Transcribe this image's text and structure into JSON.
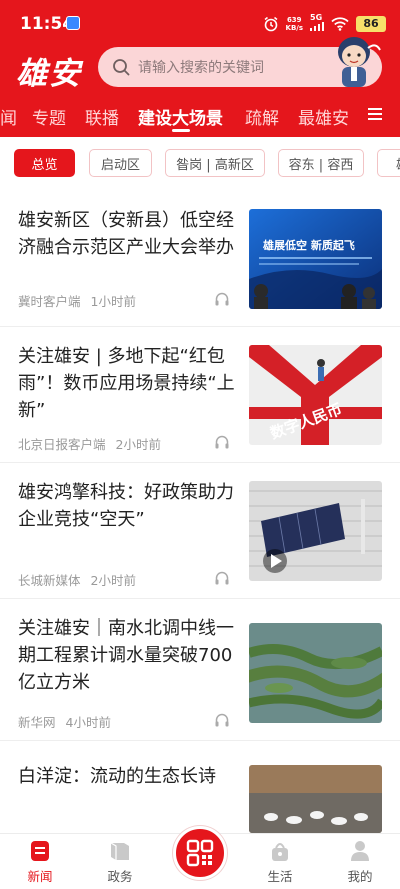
{
  "status_bar": {
    "time": "11:54",
    "net_speed_value": "639",
    "net_speed_unit": "KB/s",
    "signal": "5G",
    "battery": "86"
  },
  "header": {
    "logo": "雄安",
    "search_placeholder": "请输入搜索的关键词"
  },
  "tabs": [
    {
      "label": "闻"
    },
    {
      "label": "专题"
    },
    {
      "label": "联播"
    },
    {
      "label": "建设大场景"
    },
    {
      "label": "疏解"
    },
    {
      "label": "最雄安"
    }
  ],
  "chips": [
    {
      "label": "总览"
    },
    {
      "label": "启动区"
    },
    {
      "label": "昝岗 | 高新区"
    },
    {
      "label": "容东 | 容西"
    },
    {
      "label": "雄"
    }
  ],
  "news": [
    {
      "title": "雄安新区（安新县）低空经济融合示范区产业大会举办",
      "source": "冀时客户端",
      "time": "1小时前",
      "thumb_text_1": "雄展低空  新质起飞"
    },
    {
      "title": "关注雄安 | 多地下起“红包雨”！数币应用场景持续“上新”",
      "source": "北京日报客户端",
      "time": "2小时前",
      "thumb_text_1": "数字人民币"
    },
    {
      "title": "雄安鸿擎科技：好政策助力企业竞技“空天”",
      "source": "长城新媒体",
      "time": "2小时前"
    },
    {
      "title": "关注雄安｜南水北调中线一期工程累计调水量突破700亿立方米",
      "source": "新华网",
      "time": "4小时前"
    },
    {
      "title": "白洋淀：流动的生态长诗"
    }
  ],
  "bottom_nav": [
    {
      "label": "新闻"
    },
    {
      "label": "政务"
    },
    {
      "label": "生活"
    },
    {
      "label": "我的"
    }
  ],
  "colors": {
    "brand_red": "#e5161c",
    "search_bg": "#fbd6d7"
  }
}
